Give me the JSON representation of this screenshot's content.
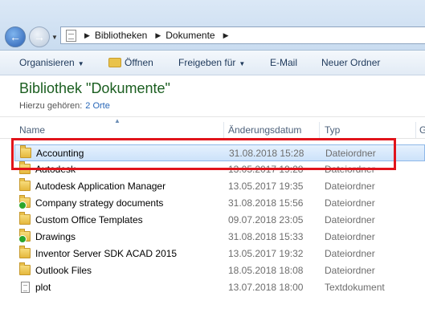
{
  "navigation": {
    "back_icon": "back-arrow-icon",
    "forward_icon": "forward-arrow-icon",
    "breadcrumbs": [
      "Bibliotheken",
      "Dokumente"
    ]
  },
  "toolbar": {
    "organize": "Organisieren",
    "open": "Öffnen",
    "share": "Freigeben für",
    "email": "E-Mail",
    "new_folder": "Neuer Ordner"
  },
  "library": {
    "title": "Bibliothek \"Dokumente\"",
    "includes_label": "Hierzu gehören:",
    "includes_link": "2 Orte"
  },
  "columns": {
    "name": "Name",
    "date": "Änderungsdatum",
    "type": "Typ",
    "extra": "G"
  },
  "files": [
    {
      "name": "Accounting",
      "date": "31.08.2018 15:28",
      "type": "Dateiordner",
      "icon": "folder-icon"
    },
    {
      "name": "Autodesk",
      "date": "13.05.2017 19:28",
      "type": "Dateiordner",
      "icon": "folder-icon"
    },
    {
      "name": "Autodesk Application Manager",
      "date": "13.05.2017 19:35",
      "type": "Dateiordner",
      "icon": "folder-icon"
    },
    {
      "name": "Company strategy documents",
      "date": "31.08.2018 15:56",
      "type": "Dateiordner",
      "icon": "folder-sync-icon"
    },
    {
      "name": "Custom Office Templates",
      "date": "09.07.2018 23:05",
      "type": "Dateiordner",
      "icon": "folder-icon"
    },
    {
      "name": "Drawings",
      "date": "31.08.2018 15:33",
      "type": "Dateiordner",
      "icon": "folder-sync-icon"
    },
    {
      "name": "Inventor Server SDK ACAD 2015",
      "date": "13.05.2017 19:32",
      "type": "Dateiordner",
      "icon": "folder-icon"
    },
    {
      "name": "Outlook Files",
      "date": "18.05.2018 18:08",
      "type": "Dateiordner",
      "icon": "folder-icon"
    },
    {
      "name": "plot",
      "date": "13.07.2018 18:00",
      "type": "Textdokument",
      "icon": "text-file-icon"
    }
  ],
  "colors": {
    "accent": "#1b5e20",
    "link": "#2867b8",
    "highlight": "#e1141b"
  }
}
